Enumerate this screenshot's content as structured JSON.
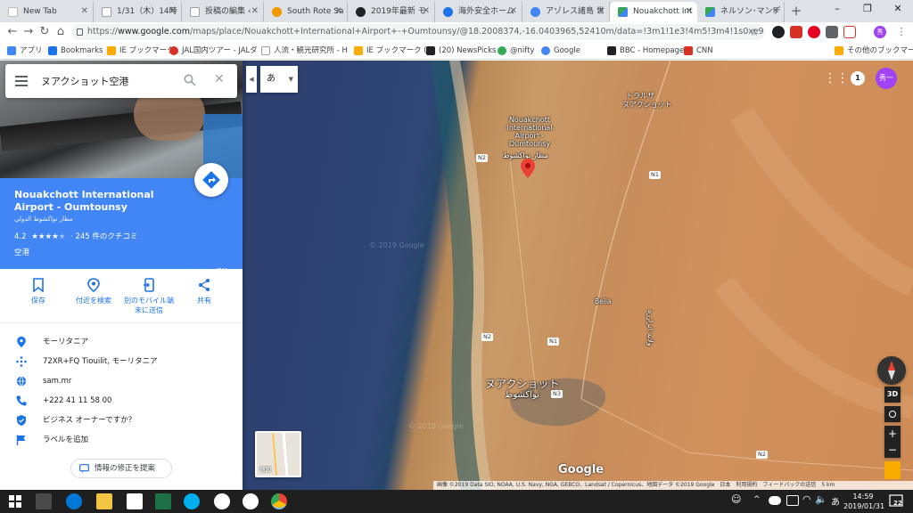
{
  "browser": {
    "tabs": [
      {
        "title": "New Tab",
        "favicon_color": "#dee1e6"
      },
      {
        "title": "1/31（木）14時",
        "favicon_color": "#9aa0a6"
      },
      {
        "title": "投稿の編集 ‹ ",
        "favicon_color": "#9aa0a6"
      },
      {
        "title": "South Rote Sa",
        "favicon_color": "#f29900"
      },
      {
        "title": "2019年最新 モ",
        "favicon_color": "#34a853"
      },
      {
        "title": "海外安全ホーム",
        "favicon_color": "#1a73e8"
      },
      {
        "title": "アゾレス諸島 世",
        "favicon_color": "#4285f4"
      },
      {
        "title": "Nouakchott Int",
        "favicon_color": "#34a853",
        "active": true
      },
      {
        "title": "ネルソン･マンデ",
        "favicon_color": "#34a853"
      }
    ],
    "new_tab": "+",
    "window_controls": [
      "–",
      "❐",
      "✕"
    ],
    "nav": {
      "back": "←",
      "forward": "→",
      "reload": "↻",
      "home": "⌂"
    },
    "url": {
      "scheme": "https://",
      "host": "www.google.com",
      "path": "/maps/place/Nouakchott+International+Airport+-+Oumtounsy/@18.2008374,-16.0403965,52410m/data=!3m1!1e3!4m5!3m4!1s0xe97b01dc6d8dab5:0..."
    },
    "star": "☆",
    "profile_initial": "秀",
    "bookmarks": [
      {
        "label": "アプリ",
        "color": "#4285f4"
      },
      {
        "label": "Bookmarks",
        "color": "#1a73e8"
      },
      {
        "label": "IE ブックマーク",
        "color": "#f9ab00"
      },
      {
        "label": "JAL国内ツアー - JALダ",
        "color": "#d93025"
      },
      {
        "label": "人流・観光研究所 - H",
        "color": "#9aa0a6"
      },
      {
        "label": "IE ブックマーク (1)",
        "color": "#f9ab00"
      },
      {
        "label": "(20) NewsPicks",
        "color": "#202124"
      },
      {
        "label": "@nifty",
        "color": "#34a853"
      },
      {
        "label": "Google",
        "color": "#4285f4"
      },
      {
        "label": "BBC - Homepage",
        "color": "#202124"
      },
      {
        "label": "CNN",
        "color": "#d93025"
      },
      {
        "label": "その他のブックマーク",
        "color": "#f9ab00"
      }
    ]
  },
  "panel": {
    "search_value": "ヌアクショット空港",
    "title_en": "Nouakchott International Airport - Oumtounsy",
    "title_ar": "مطار نواكشوط الدولي",
    "rating": "4.2",
    "stars": "★★★★",
    "star_empty": "★",
    "reviews": "245 件のクチコミ",
    "category": "空港",
    "directions_label": "ルート・乗換",
    "actions": [
      {
        "label": "保存",
        "icon": "bookmark-icon"
      },
      {
        "label": "付近を検索",
        "icon": "nearby-icon"
      },
      {
        "label": "別のモバイル端末に送信",
        "icon": "send-to-phone-icon"
      },
      {
        "label": "共有",
        "icon": "share-icon"
      }
    ],
    "info": [
      {
        "text": "モーリタニア",
        "icon": "location-pin-icon"
      },
      {
        "text": "72XR+FQ Tiouilit, モーリタニア",
        "icon": "plus-code-icon"
      },
      {
        "text": "sam.mr",
        "icon": "globe-icon"
      },
      {
        "text": "+222 41 11 58 00",
        "icon": "phone-icon"
      },
      {
        "text": "ビジネス オーナーですか？",
        "icon": "verified-icon"
      },
      {
        "text": "ラベルを追加",
        "icon": "flag-icon"
      }
    ],
    "suggest_edit": "情報の修正を提案"
  },
  "map": {
    "lang_toggle": "あ",
    "labels": {
      "airport": "Nouakchott International Airport - Oumtounsy",
      "airport_ar": "مطار نواكشوط",
      "trarza": "トラルザ",
      "trarza2": "ヌアクショット",
      "city": "ヌアクショット",
      "city_ar": "نواكشوط",
      "beila": "Beila",
      "vertical": "ولاية اترارزة",
      "watermark1": "© 2019 Google",
      "watermark2": "© 2019 Google"
    },
    "roads": [
      "N2",
      "N1",
      "N2",
      "N1",
      "N3",
      "N2"
    ],
    "notifications": "1",
    "avatar": "秀一",
    "controls": {
      "tilt": "3D",
      "zoom_in": "+",
      "zoom_out": "−"
    },
    "layer_label": "地図",
    "google_logo": "Google",
    "footer": "画像 ©2019 Data SIO, NOAA, U.S. Navy, NGA, GEBCO、Landsat / Copernicus、地図データ ©2019 Google　日本　利用規約　フィードバックの送信　5 km"
  },
  "taskbar": {
    "time": "14:59",
    "date": "2019/01/31",
    "lang": "あ",
    "notif_count": "22"
  },
  "colors": {
    "accent": "#4285f4",
    "link": "#1a73e8",
    "pin": "#ea4335",
    "taskbar": "#1f1f1f"
  }
}
